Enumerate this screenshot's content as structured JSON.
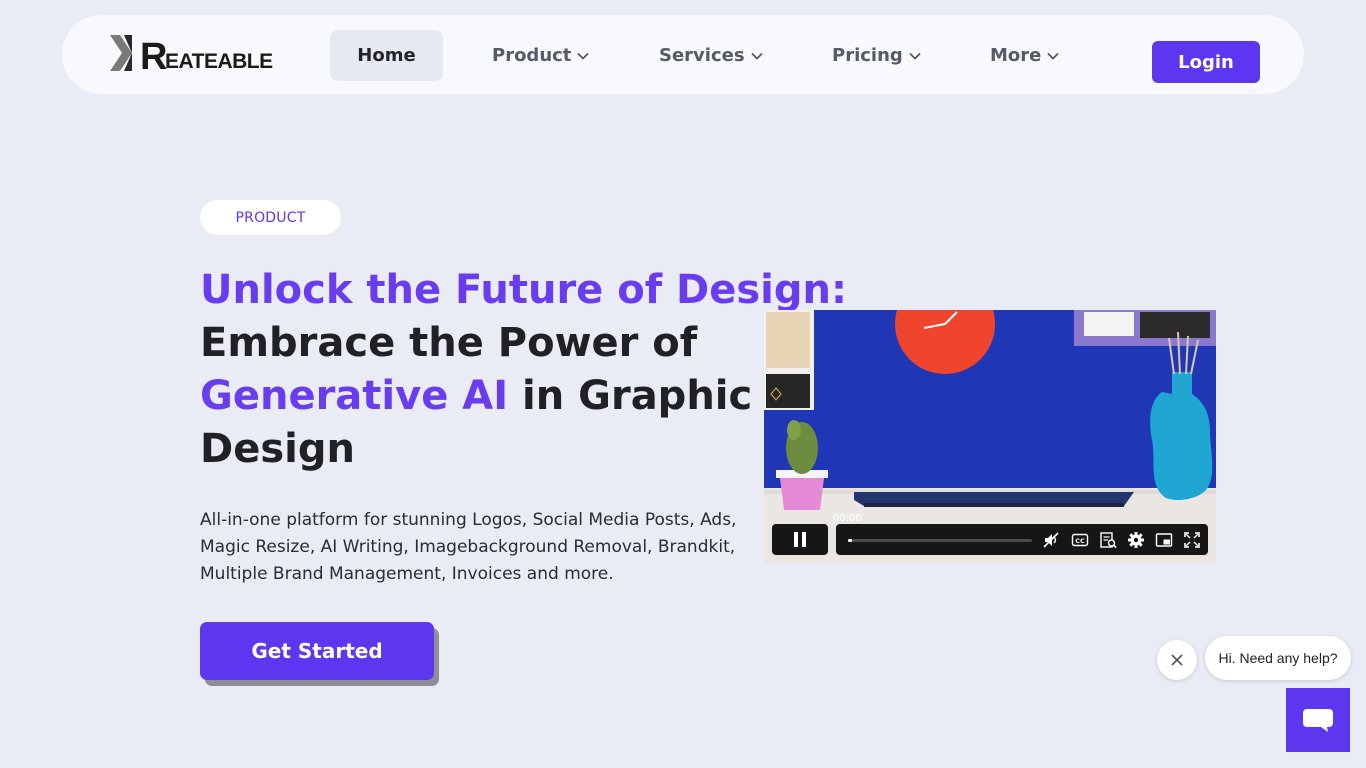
{
  "brand": {
    "logo_alt": "KREATEABLE",
    "logo_big": "R",
    "logo_small": "EATEABLE"
  },
  "nav": {
    "home": "Home",
    "product": "Product",
    "services": "Services",
    "pricing": "Pricing",
    "more": "More",
    "login": "Login"
  },
  "hero": {
    "pill": "PRODUCT",
    "line1": "Unlock the Future of Design:",
    "line2": "Embrace the Power of",
    "line3_accent": "Generative AI",
    "line3_rest": " in Graphic",
    "line4": "Design",
    "subtitle": "All-in-one platform for stunning Logos, Social Media Posts, Ads, Magic Resize, AI Writing, Imagebackground Removal, Brandkit, Multiple Brand Management, Invoices and more.",
    "cta": "Get Started"
  },
  "video": {
    "timecode": "00:00",
    "progress": 0.02,
    "icons": [
      "pause-icon",
      "mute-icon",
      "captions-icon",
      "transcript-icon",
      "settings-icon",
      "pip-icon",
      "fullscreen-icon"
    ]
  },
  "chat": {
    "message": "Hi. Need any help?",
    "icons": [
      "close-icon",
      "chat-icon"
    ]
  },
  "colors": {
    "accent": "#5d36f0",
    "headline_accent": "#6a3cf0",
    "background": "#e9ebf5"
  }
}
